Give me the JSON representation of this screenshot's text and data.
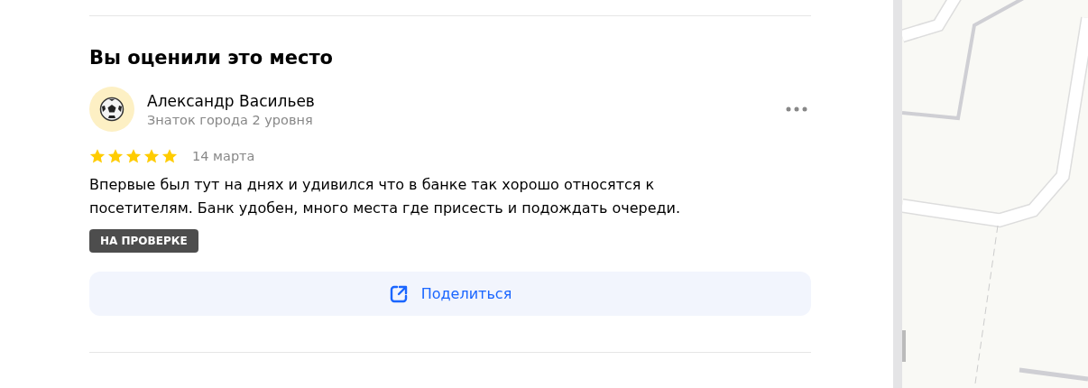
{
  "section_title": "Вы оценили это место",
  "review": {
    "author": "Александр Васильев",
    "author_status": "Знаток города 2 уровня",
    "stars": 5,
    "date": "14 марта",
    "text": "Впервые был тут на днях и удивился что в банке так хорошо относятся к посетителям. Банк удобен, много места где присесть и подождать очереди.",
    "status_badge": "НА ПРОВЕРКЕ"
  },
  "share_button": {
    "label": "Поделиться"
  }
}
